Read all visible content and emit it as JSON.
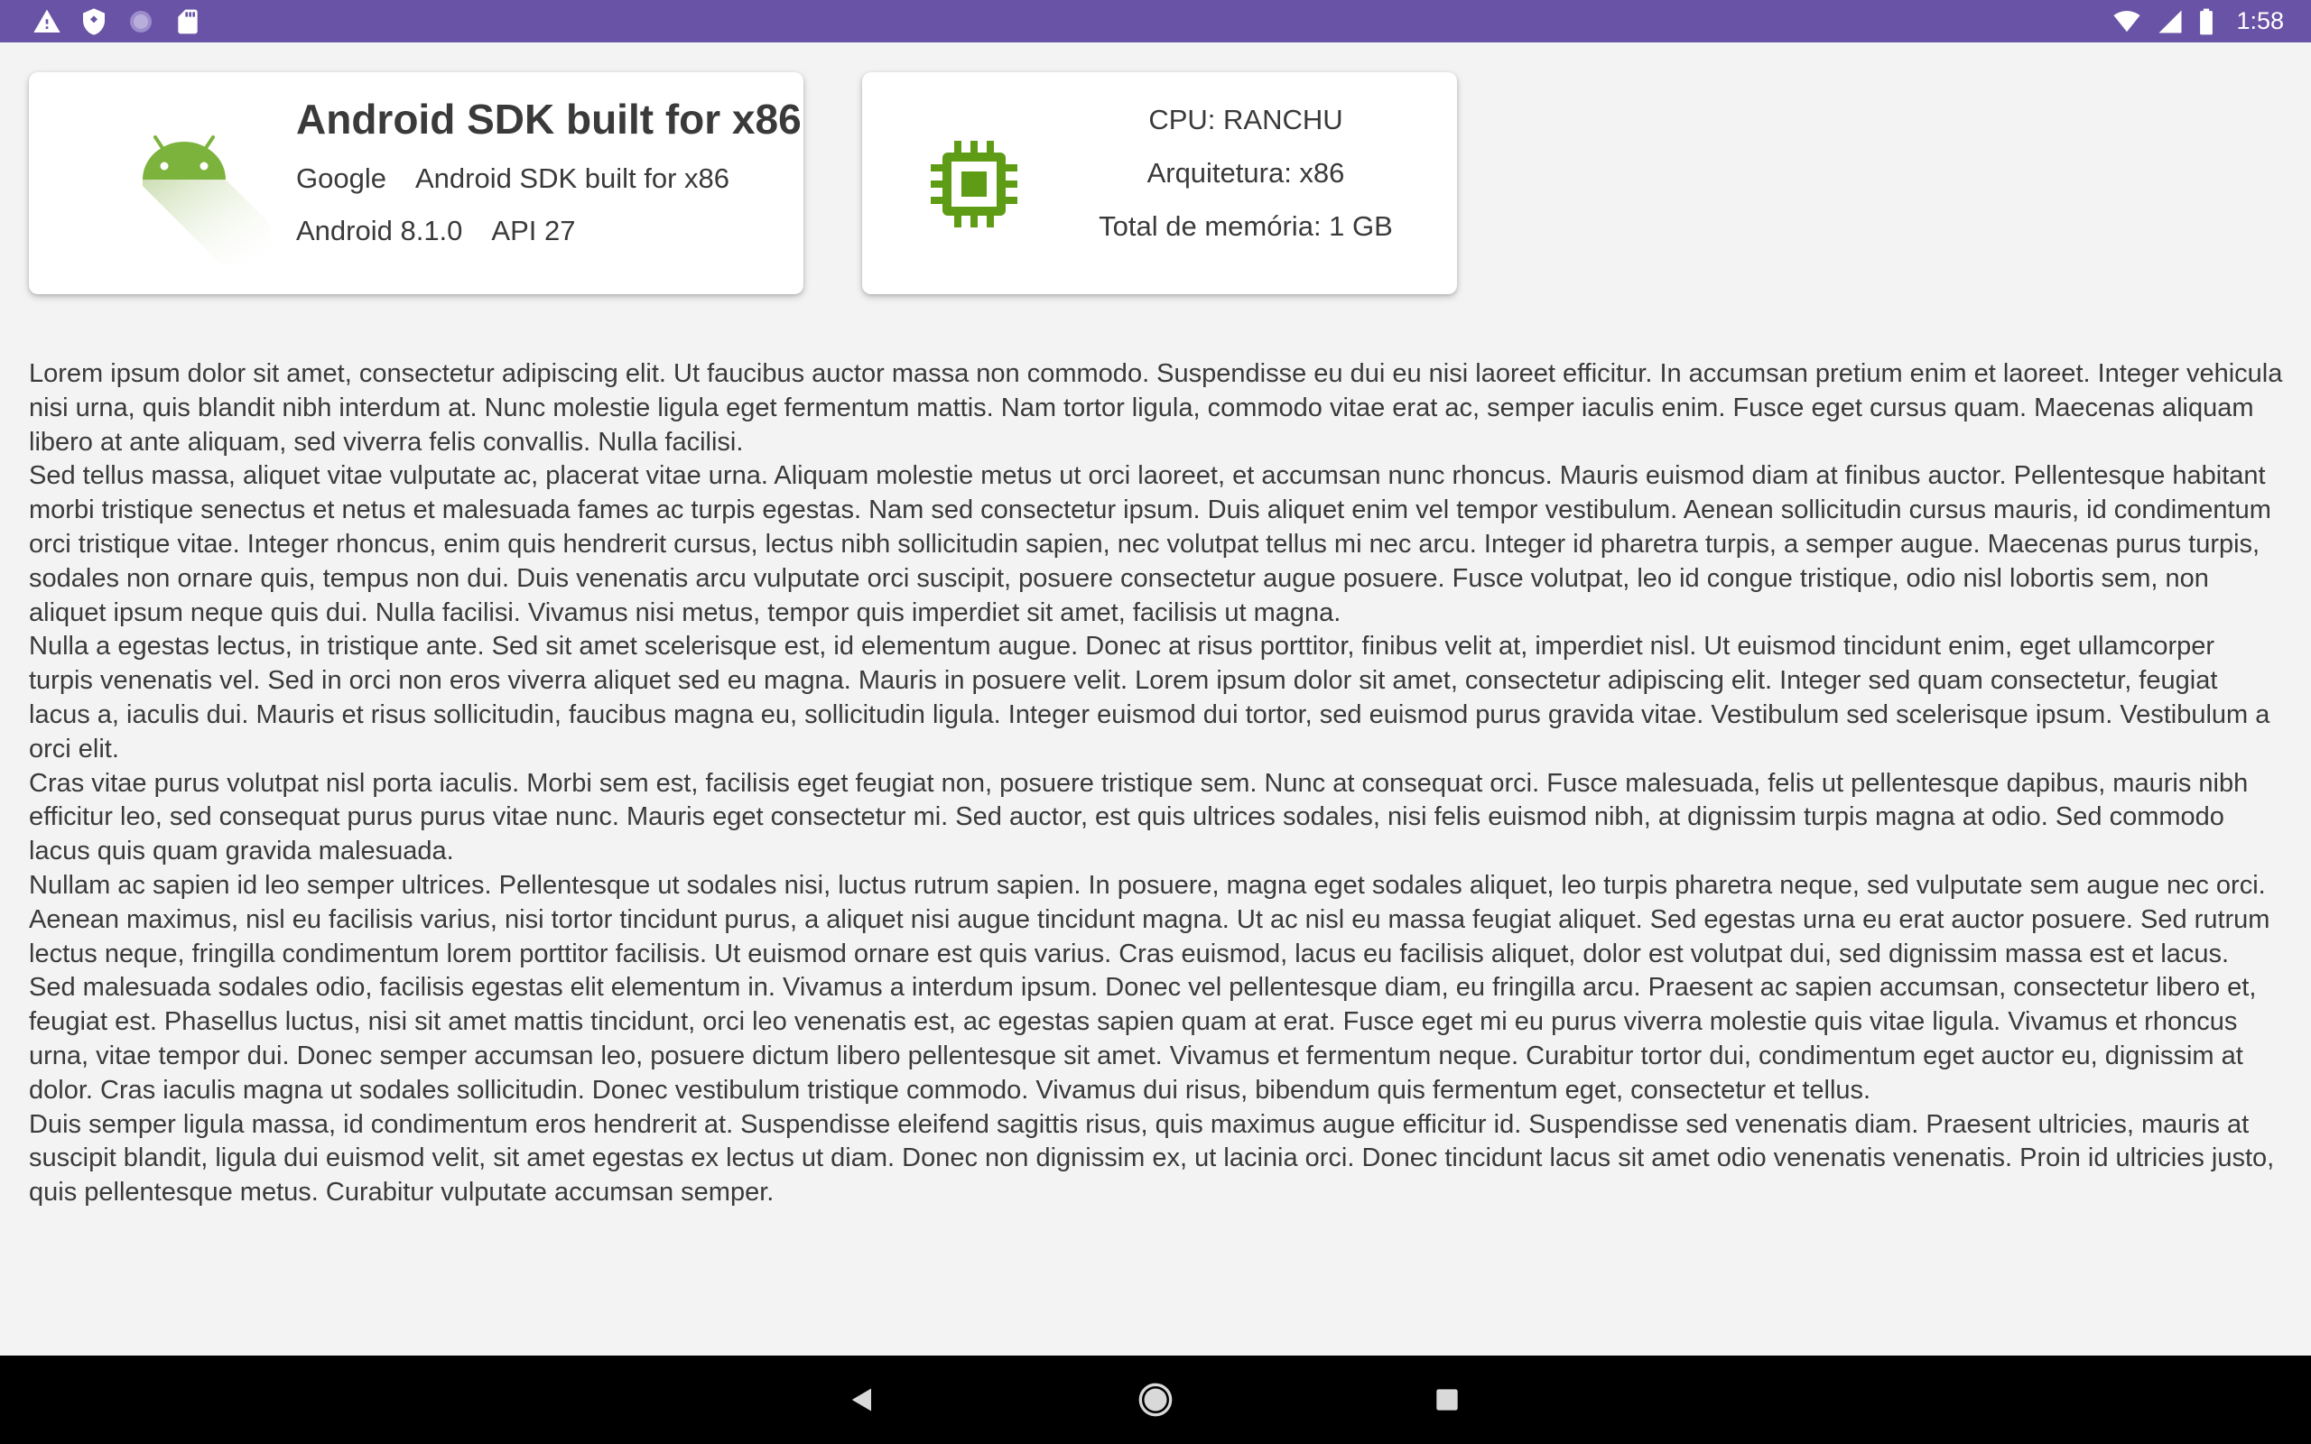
{
  "status_bar": {
    "time": "1:58",
    "left_icons": [
      "warning-icon",
      "shield-icon",
      "sync-icon",
      "sd-card-icon"
    ],
    "right_icons": [
      "wifi-icon",
      "signal-icon",
      "battery-icon"
    ],
    "background_color": "#6953a6"
  },
  "device_card": {
    "title": "Android SDK built for x86",
    "manufacturer": "Google",
    "model": "Android SDK built for x86",
    "android_version": "Android 8.1.0",
    "api_level": "API 27",
    "icon": "android-robot-icon",
    "icon_color": "#7cb33d"
  },
  "cpu_card": {
    "cpu": "CPU: RANCHU",
    "architecture": "Arquitetura: x86",
    "memory": "Total de memória: 1 GB",
    "icon": "cpu-chip-icon",
    "icon_color": "#5f9c16"
  },
  "content": {
    "paragraphs": [
      "Lorem ipsum dolor sit amet, consectetur adipiscing elit. Ut faucibus auctor massa non commodo. Suspendisse eu dui eu nisi laoreet efficitur. In accumsan pretium enim et laoreet. Integer vehicula nisi urna, quis blandit nibh interdum at. Nunc molestie ligula eget fermentum mattis. Nam tortor ligula, commodo vitae erat ac, semper iaculis enim. Fusce eget cursus quam. Maecenas aliquam libero at ante aliquam, sed viverra felis convallis. Nulla facilisi.",
      " Sed tellus massa, aliquet vitae vulputate ac, placerat vitae urna. Aliquam molestie metus ut orci laoreet, et accumsan nunc rhoncus. Mauris euismod diam at finibus auctor. Pellentesque habitant morbi tristique senectus et netus et malesuada fames ac turpis egestas. Nam sed consectetur ipsum. Duis aliquet enim vel tempor vestibulum. Aenean sollicitudin cursus mauris, id condimentum orci tristique vitae. Integer rhoncus, enim quis hendrerit cursus, lectus nibh sollicitudin sapien, nec volutpat tellus mi nec arcu. Integer id pharetra turpis, a semper augue. Maecenas purus turpis, sodales non ornare quis, tempus non dui. Duis venenatis arcu vulputate orci suscipit, posuere consectetur augue posuere. Fusce volutpat, leo id congue tristique, odio nisl lobortis sem, non aliquet ipsum neque quis dui. Nulla facilisi. Vivamus nisi metus, tempor quis imperdiet sit amet, facilisis ut magna.",
      " Nulla a egestas lectus, in tristique ante. Sed sit amet scelerisque est, id elementum augue. Donec at risus porttitor, finibus velit at, imperdiet nisl. Ut euismod tincidunt enim, eget ullamcorper turpis venenatis vel. Sed in orci non eros viverra aliquet sed eu magna. Mauris in posuere velit. Lorem ipsum dolor sit amet, consectetur adipiscing elit. Integer sed quam consectetur, feugiat lacus a, iaculis dui. Mauris et risus sollicitudin, faucibus magna eu, sollicitudin ligula. Integer euismod dui tortor, sed euismod purus gravida vitae. Vestibulum sed scelerisque ipsum. Vestibulum a orci elit.",
      " Cras vitae purus volutpat nisl porta iaculis. Morbi sem est, facilisis eget feugiat non, posuere tristique sem. Nunc at consequat orci. Fusce malesuada, felis ut pellentesque dapibus, mauris nibh efficitur leo, sed consequat purus purus vitae nunc. Mauris eget consectetur mi. Sed auctor, est quis ultrices sodales, nisi felis euismod nibh, at dignissim turpis magna at odio. Sed commodo lacus quis quam gravida malesuada.",
      " Nullam ac sapien id leo semper ultrices. Pellentesque ut sodales nisi, luctus rutrum sapien. In posuere, magna eget sodales aliquet, leo turpis pharetra neque, sed vulputate sem augue nec orci. Aenean maximus, nisl eu facilisis varius, nisi tortor tincidunt purus, a aliquet nisi augue tincidunt magna. Ut ac nisl eu massa feugiat aliquet. Sed egestas urna eu erat auctor posuere. Sed rutrum lectus neque, fringilla condimentum lorem porttitor facilisis. Ut euismod ornare est quis varius. Cras euismod, lacus eu facilisis aliquet, dolor est volutpat dui, sed dignissim massa est et lacus.",
      " Sed malesuada sodales odio, facilisis egestas elit elementum in. Vivamus a interdum ipsum. Donec vel pellentesque diam, eu fringilla arcu. Praesent ac sapien accumsan, consectetur libero et, feugiat est. Phasellus luctus, nisi sit amet mattis tincidunt, orci leo venenatis est, ac egestas sapien quam at erat. Fusce eget mi eu purus viverra molestie quis vitae ligula. Vivamus et rhoncus urna, vitae tempor dui. Donec semper accumsan leo, posuere dictum libero pellentesque sit amet. Vivamus et fermentum neque. Curabitur tortor dui, condimentum eget auctor eu, dignissim at dolor. Cras iaculis magna ut sodales sollicitudin. Donec vestibulum tristique commodo. Vivamus dui risus, bibendum quis fermentum eget, consectetur et tellus.",
      " Duis semper ligula massa, id condimentum eros hendrerit at. Suspendisse eleifend sagittis risus, quis maximus augue efficitur id. Suspendisse sed venenatis diam. Praesent ultricies, mauris at suscipit blandit, ligula dui euismod velit, sit amet egestas ex lectus ut diam. Donec non dignissim ex, ut lacinia orci. Donec tincidunt lacus sit amet odio venenatis venenatis. Proin id ultricies justo, quis pellentesque metus. Curabitur vulputate accumsan semper."
    ]
  },
  "nav_bar": {
    "buttons": [
      "back-icon",
      "home-icon",
      "recents-icon"
    ]
  }
}
